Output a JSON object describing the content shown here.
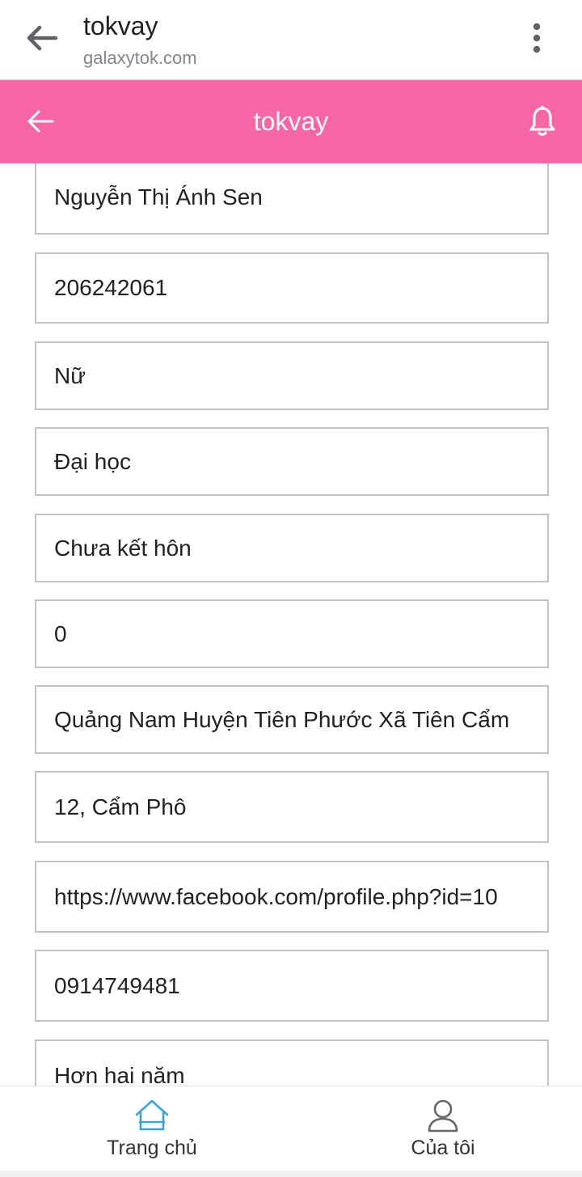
{
  "browser": {
    "title": "tokvay",
    "url": "galaxytok.com",
    "back_icon": "arrow-left-icon",
    "menu_icon": "more-vertical-icon"
  },
  "header": {
    "title": "tokvay",
    "back_icon": "arrow-left-icon",
    "bell_icon": "bell-icon",
    "background_color": "#f766a6"
  },
  "form": {
    "fields": [
      {
        "value": "Nguyễn Thị Ánh Sen"
      },
      {
        "value": "206242061"
      },
      {
        "value": "Nữ"
      },
      {
        "value": "Đại học"
      },
      {
        "value": "Chưa kết hôn"
      },
      {
        "value": "0"
      },
      {
        "value": "Quảng Nam Huyện Tiên Phước Xã Tiên Cẩm"
      },
      {
        "value": "12, Cẩm Phô"
      },
      {
        "value": "https://www.facebook.com/profile.php?id=10"
      },
      {
        "value": "0914749481"
      },
      {
        "value": "Hơn hai năm"
      }
    ]
  },
  "bottom_nav": {
    "home_label": "Trang chủ",
    "me_label": "Của tôi",
    "home_icon": "home-icon",
    "me_icon": "user-icon",
    "active_color": "#3ba2dc"
  }
}
